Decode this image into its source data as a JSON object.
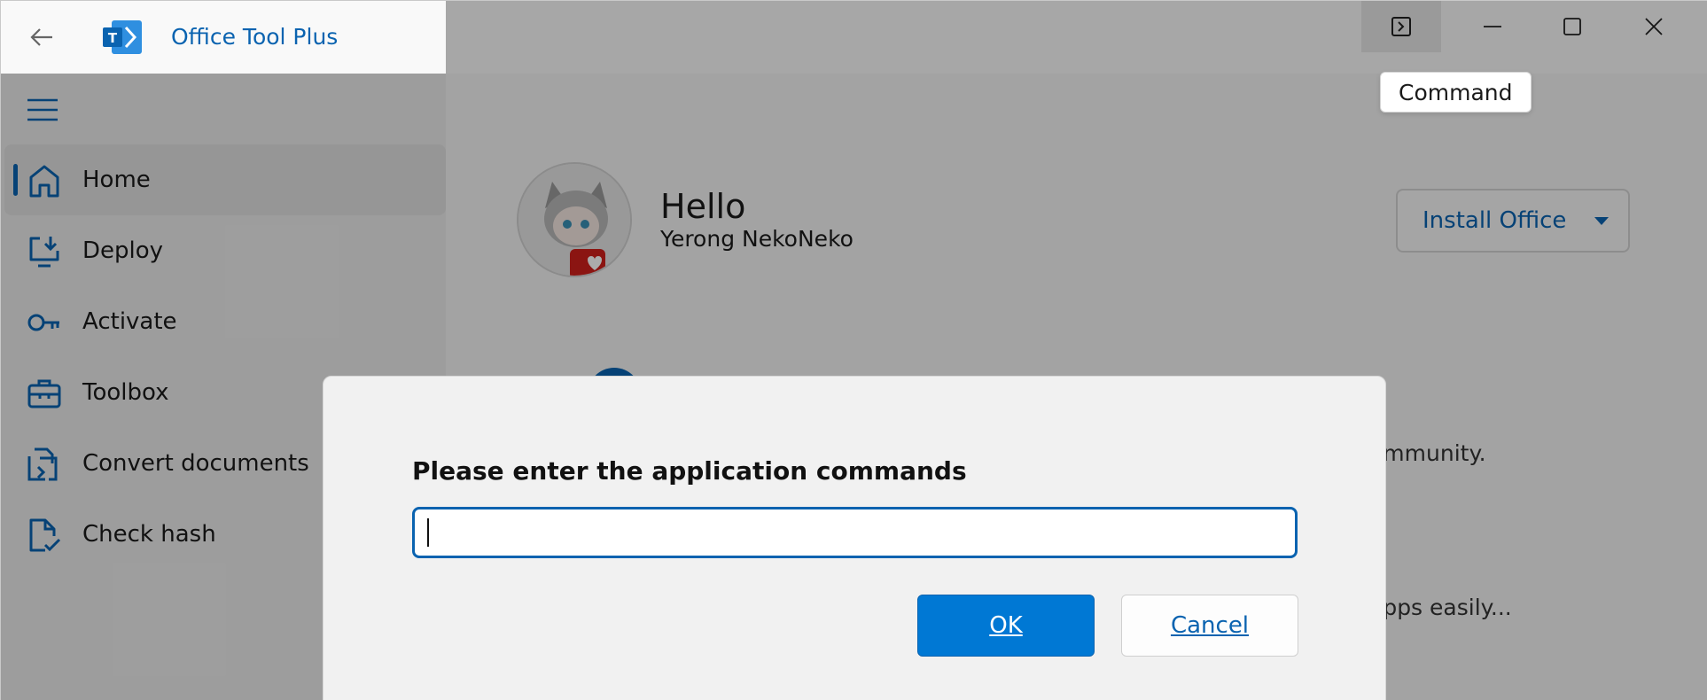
{
  "window": {
    "title": "Office Tool Plus"
  },
  "titlebar": {
    "tooltip": "Command"
  },
  "sidebar": {
    "items": [
      {
        "label": "Home",
        "icon": "home-icon",
        "active": true
      },
      {
        "label": "Deploy",
        "icon": "deploy-icon",
        "active": false
      },
      {
        "label": "Activate",
        "icon": "key-icon",
        "active": false
      },
      {
        "label": "Toolbox",
        "icon": "toolbox-icon",
        "active": false
      },
      {
        "label": "Convert documents",
        "icon": "convert-documents-icon",
        "active": false
      },
      {
        "label": "Check hash",
        "icon": "check-hash-icon",
        "active": false
      }
    ]
  },
  "main": {
    "greeting": "Hello",
    "username": "Yerong NekoNeko",
    "install_button": "Install Office",
    "feature_text_1": "ommunity.",
    "feature_text_2": "apps easily..."
  },
  "dialog": {
    "title": "Please enter the application commands",
    "input_value": "",
    "ok_label": "OK",
    "cancel_label": "Cancel"
  },
  "colors": {
    "accent": "#0078d4",
    "brand": "#0a63b0"
  }
}
